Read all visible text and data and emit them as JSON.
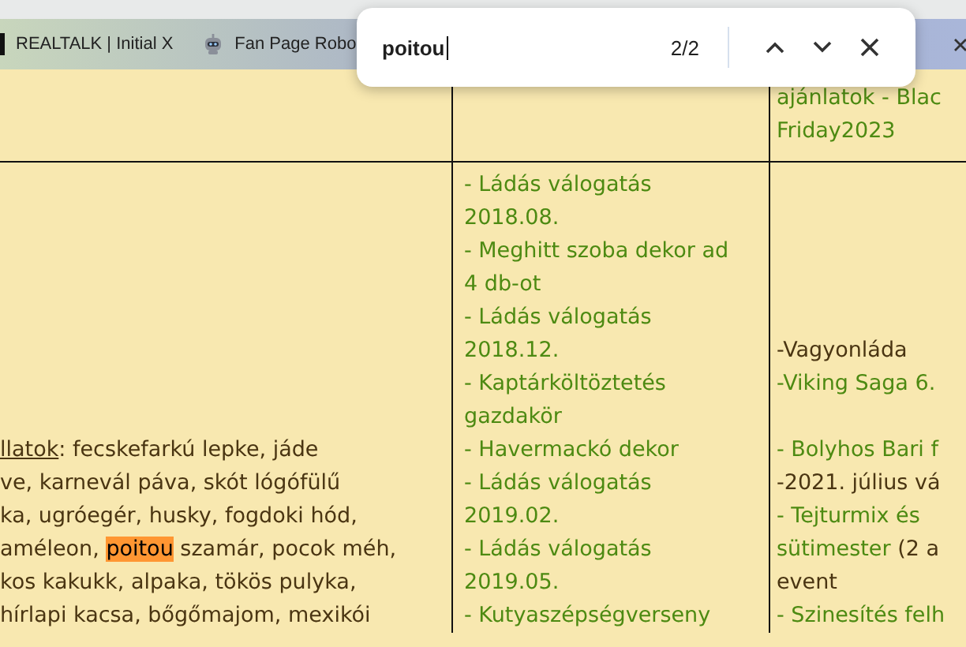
{
  "tabs": [
    {
      "title": "REALTALK | Initial X"
    },
    {
      "title": "Fan Page Robo"
    }
  ],
  "find": {
    "value": "poitou",
    "count": "2/2"
  },
  "table": {
    "rows": [
      {
        "cells": [
          {},
          {},
          {
            "lines": [
              {
                "segs": [
                  {
                    "kind": "link",
                    "text": "ajánlatok - Blac"
                  }
                ]
              },
              {
                "segs": [
                  {
                    "kind": "link",
                    "text": "Friday2023"
                  }
                ]
              }
            ]
          }
        ]
      },
      {
        "cells": [
          {
            "lines": [
              {
                "segs": [
                  {
                    "kind": "anchor",
                    "text": "llatok"
                  },
                  {
                    "kind": "text",
                    "text": ": fecskefarkú lepke, jáde"
                  }
                ]
              },
              {
                "segs": [
                  {
                    "kind": "text",
                    "text": "ve, karnevál páva, skót lógófülű"
                  }
                ]
              },
              {
                "segs": [
                  {
                    "kind": "text",
                    "text": "ka, ugróegér, husky, fogdoki hód,"
                  }
                ]
              },
              {
                "segs": [
                  {
                    "kind": "text",
                    "text": "améleon, "
                  },
                  {
                    "kind": "match",
                    "text": "poitou"
                  },
                  {
                    "kind": "text",
                    "text": " szamár, pocok méh,"
                  }
                ]
              },
              {
                "segs": [
                  {
                    "kind": "text",
                    "text": "kos kakukk, alpaka, tökös pulyka,"
                  }
                ]
              },
              {
                "segs": [
                  {
                    "kind": "text",
                    "text": "hírlapi kacsa, bőgőmajom, mexikói"
                  }
                ]
              }
            ]
          },
          {
            "lines": [
              {
                "segs": [
                  {
                    "kind": "link",
                    "text": "- Ládás válogatás"
                  }
                ]
              },
              {
                "segs": [
                  {
                    "kind": "link",
                    "text": "2018.08."
                  }
                ]
              },
              {
                "segs": [
                  {
                    "kind": "link",
                    "text": "- Meghitt szoba dekor ad"
                  }
                ]
              },
              {
                "segs": [
                  {
                    "kind": "link",
                    "text": "4 db-ot"
                  }
                ]
              },
              {
                "segs": [
                  {
                    "kind": "link",
                    "text": "- Ládás válogatás"
                  }
                ]
              },
              {
                "segs": [
                  {
                    "kind": "link",
                    "text": "2018.12."
                  }
                ]
              },
              {
                "segs": [
                  {
                    "kind": "link",
                    "text": "- Kaptárköltöztetés"
                  }
                ]
              },
              {
                "segs": [
                  {
                    "kind": "link",
                    "text": "gazdakör"
                  }
                ]
              },
              {
                "segs": [
                  {
                    "kind": "link",
                    "text": "- Havermackó dekor"
                  }
                ]
              },
              {
                "segs": [
                  {
                    "kind": "link",
                    "text": "- Ládás válogatás"
                  }
                ]
              },
              {
                "segs": [
                  {
                    "kind": "link",
                    "text": "2019.02."
                  }
                ]
              },
              {
                "segs": [
                  {
                    "kind": "link",
                    "text": "- Ládás válogatás"
                  }
                ]
              },
              {
                "segs": [
                  {
                    "kind": "link",
                    "text": "2019.05."
                  }
                ]
              },
              {
                "segs": [
                  {
                    "kind": "link",
                    "text": "- Kutyaszépségverseny"
                  }
                ]
              }
            ]
          },
          {
            "lines": [
              {
                "segs": [
                  {
                    "kind": "text",
                    "text": "-Vagyonláda"
                  }
                ]
              },
              {
                "segs": [
                  {
                    "kind": "link",
                    "text": "-Viking Saga 6."
                  }
                ]
              },
              {
                "segs": [
                  {
                    "kind": "link",
                    "text": "- Bolyhos Bari f"
                  }
                ],
                "break_before": true
              },
              {
                "segs": [
                  {
                    "kind": "text",
                    "text": "-2021. július vá"
                  }
                ]
              },
              {
                "segs": [
                  {
                    "kind": "link",
                    "text": "- Tejturmix és"
                  }
                ]
              },
              {
                "segs": [
                  {
                    "kind": "link",
                    "text": "sütimester"
                  },
                  {
                    "kind": "text",
                    "text": " (2 a"
                  }
                ]
              },
              {
                "segs": [
                  {
                    "kind": "text",
                    "text": "event"
                  }
                ]
              },
              {
                "segs": [
                  {
                    "kind": "link",
                    "text": "- Szinesítés felh"
                  }
                ]
              }
            ]
          }
        ]
      }
    ]
  }
}
